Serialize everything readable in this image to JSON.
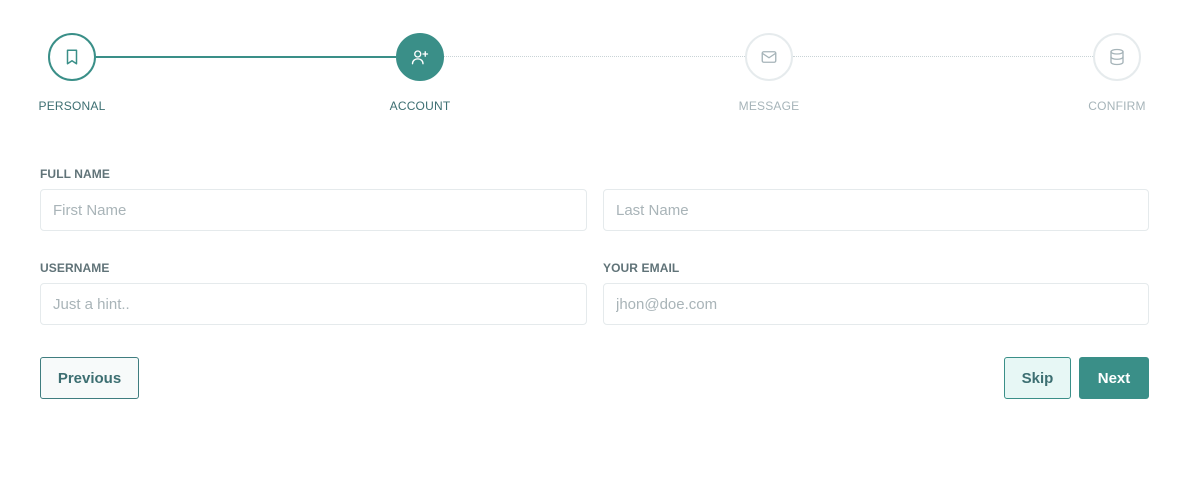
{
  "stepper": {
    "steps": [
      {
        "label": "PERSONAL",
        "icon": "bookmark-icon",
        "state": "completed"
      },
      {
        "label": "ACCOUNT",
        "icon": "user-plus-icon",
        "state": "active"
      },
      {
        "label": "MESSAGE",
        "icon": "mail-icon",
        "state": "pending"
      },
      {
        "label": "CONFIRM",
        "icon": "database-icon",
        "state": "pending"
      }
    ]
  },
  "form": {
    "full_name": {
      "label": "FULL NAME",
      "first_placeholder": "First Name",
      "last_placeholder": "Last Name"
    },
    "username": {
      "label": "USERNAME",
      "placeholder": "Just a hint.."
    },
    "email": {
      "label": "YOUR EMAIL",
      "placeholder": "jhon@doe.com"
    }
  },
  "actions": {
    "previous_label": "Previous",
    "skip_label": "Skip",
    "next_label": "Next"
  },
  "colors": {
    "accent": "#3a8f88",
    "label_active": "#3d6f72",
    "label_pending": "#a6b4b9",
    "pending_border": "#e6ebed"
  }
}
